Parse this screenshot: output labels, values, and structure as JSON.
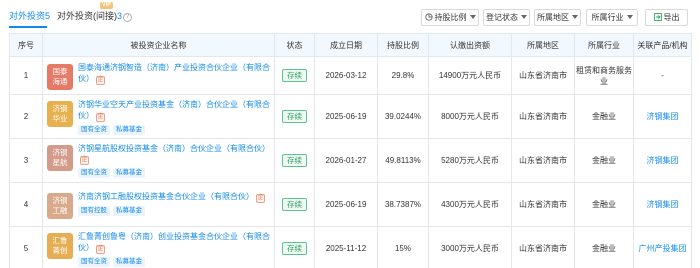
{
  "tabs": {
    "direct_label": "对外投资",
    "direct_count": "5",
    "indirect_label": "对外投资(间接)",
    "indirect_count": "3",
    "vip_badge": "VIP",
    "info_glyph": "?"
  },
  "filters": {
    "ratio": "持股比例",
    "status": "登记状态",
    "region": "所属地区",
    "industry": "所属行业",
    "export": "导出"
  },
  "table": {
    "headers": {
      "index": "序号",
      "company": "被投资企业名称",
      "status": "状态",
      "date": "成立日期",
      "ratio": "持股比例",
      "capital": "认缴出资额",
      "region": "所属地区",
      "industry": "所属行业",
      "related": "关联产品/机构"
    },
    "rows": [
      {
        "index": "1",
        "logo_text": "国泰海通",
        "logo_color": "#e47b66",
        "name": "国泰海通济钢智造（济南）产业投资合伙企业（有限合伙）",
        "tags": [],
        "status": "存续",
        "date": "2026-03-12",
        "ratio": "29.8%",
        "capital": "14900万元人民币",
        "region": "山东省济南市",
        "industry": "租赁和商务服务业",
        "related": "-"
      },
      {
        "index": "2",
        "logo_text": "济钢华业",
        "logo_color": "#e8b04f",
        "name": "济钢华业空天产业投资基金（济南）合伙企业（有限合伙）",
        "tags": [
          "国有全资",
          "私募基金"
        ],
        "status": "存续",
        "date": "2025-06-19",
        "ratio": "39.0244%",
        "capital": "8000万元人民币",
        "region": "山东省济南市",
        "industry": "金融业",
        "related": "济钢集团"
      },
      {
        "index": "3",
        "logo_text": "济钢星航",
        "logo_color": "#d49a8a",
        "name": "济钢星航股权投资基金（济南）合伙企业（有限合伙）",
        "tags": [
          "国有全资",
          "私募基金"
        ],
        "status": "存续",
        "date": "2026-01-27",
        "ratio": "49.8113%",
        "capital": "5280万元人民币",
        "region": "山东省济南市",
        "industry": "金融业",
        "related": "济钢集团"
      },
      {
        "index": "4",
        "logo_text": "济钢工融",
        "logo_color": "#d9a98c",
        "name": "济南济钢工融股权投资基金合伙企业（有限合伙）",
        "tags": [
          "国有控股",
          "私募基金"
        ],
        "status": "存续",
        "date": "2025-06-19",
        "ratio": "38.7387%",
        "capital": "4300万元人民币",
        "region": "山东省济南市",
        "industry": "金融业",
        "related": "济钢集团"
      },
      {
        "index": "5",
        "logo_text": "汇鲁菁创",
        "logo_color": "#e7ad52",
        "name": "汇鲁菁创鲁粤（济南）创业投资基金合伙企业（有限合伙）",
        "tags": [
          "国有全资",
          "私募基金"
        ],
        "status": "存续",
        "date": "2025-11-12",
        "ratio": "15%",
        "capital": "3000万元人民币",
        "region": "山东省济南市",
        "industry": "金融业",
        "related": "广州产投集团"
      }
    ]
  },
  "icons": {
    "company_badge": "企",
    "ratio_icon": "ratio-icon",
    "export_icon": "export-icon"
  },
  "colors": {
    "accent": "#128bed",
    "status_green": "#2ba25f",
    "header_bg": "#f2f8ff"
  }
}
